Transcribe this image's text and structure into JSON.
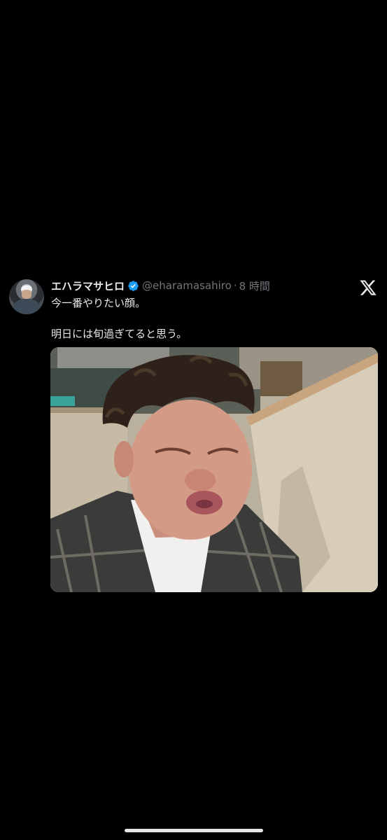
{
  "tweet": {
    "display_name": "エハラマサヒロ",
    "handle": "@eharamasahiro",
    "separator": "·",
    "time": "8 時間",
    "text_line1": "今一番やりたい顔。",
    "text_line2": "明日には旬過ぎてると思う。",
    "verified_icon": "verified-badge-icon",
    "brand_icon": "x-logo-icon",
    "photo_description": "photo"
  },
  "colors": {
    "background": "#000000",
    "primary_text": "#e7e9ea",
    "secondary_text": "#71767b",
    "verified_blue": "#1d9bf0"
  }
}
